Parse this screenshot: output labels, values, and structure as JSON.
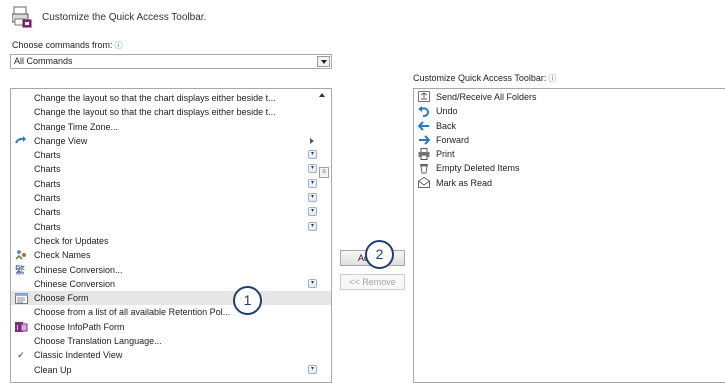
{
  "header": {
    "title": "Customize the Quick Access Toolbar."
  },
  "left": {
    "label": "Choose commands from:",
    "info_glyph": "ⓘ",
    "dropdown_value": "All Commands",
    "items": [
      {
        "text": "Change the layout so that the chart displays either beside t...",
        "icon": "",
        "marker": ""
      },
      {
        "text": "Change the layout so that the chart displays either beside t...",
        "icon": "",
        "marker": ""
      },
      {
        "text": "Change Time Zone...",
        "icon": "",
        "marker": ""
      },
      {
        "text": "Change View",
        "icon": "change-view-icon",
        "marker": "arrow"
      },
      {
        "text": "Charts",
        "icon": "",
        "marker": "dropdown"
      },
      {
        "text": "Charts",
        "icon": "",
        "marker": "dropdown"
      },
      {
        "text": "Charts",
        "icon": "",
        "marker": "dropdown"
      },
      {
        "text": "Charts",
        "icon": "",
        "marker": "dropdown"
      },
      {
        "text": "Charts",
        "icon": "",
        "marker": "dropdown"
      },
      {
        "text": "Charts",
        "icon": "",
        "marker": "dropdown"
      },
      {
        "text": "Check for Updates",
        "icon": "",
        "marker": ""
      },
      {
        "text": "Check Names",
        "icon": "check-names-icon",
        "marker": ""
      },
      {
        "text": "Chinese Conversion...",
        "icon": "chinese-conversion-icon",
        "marker": ""
      },
      {
        "text": "Chinese Conversion",
        "icon": "",
        "marker": "dropdown"
      },
      {
        "text": "Choose Form",
        "icon": "choose-form-icon",
        "marker": "",
        "selected": true
      },
      {
        "text": "Choose from a list of all available Retention Pol...",
        "icon": "",
        "marker": ""
      },
      {
        "text": "Choose InfoPath Form",
        "icon": "infopath-icon",
        "marker": ""
      },
      {
        "text": "Choose Translation Language...",
        "icon": "",
        "marker": ""
      },
      {
        "text": "Classic Indented View",
        "icon": "checkmark-icon",
        "marker": ""
      },
      {
        "text": "Clean Up",
        "icon": "",
        "marker": "dropdown"
      }
    ]
  },
  "buttons": {
    "add_label": "Add >>",
    "remove_label": "<< Remove"
  },
  "right": {
    "label": "Customize Quick Access Toolbar:",
    "info_glyph": "ⓘ",
    "items": [
      {
        "text": "Send/Receive All Folders",
        "icon": "send-receive-icon"
      },
      {
        "text": "Undo",
        "icon": "undo-icon"
      },
      {
        "text": "Back",
        "icon": "back-arrow-icon"
      },
      {
        "text": "Forward",
        "icon": "forward-arrow-icon"
      },
      {
        "text": "Print",
        "icon": "print-icon"
      },
      {
        "text": "Empty Deleted Items",
        "icon": "trash-icon"
      },
      {
        "text": "Mark as Read",
        "icon": "envelope-open-icon"
      }
    ]
  },
  "callouts": {
    "one": "1",
    "two": "2"
  },
  "colors": {
    "accent": "#2b79c2",
    "callout_border": "#1f3f74",
    "selected_row": "#e6e6e6"
  }
}
